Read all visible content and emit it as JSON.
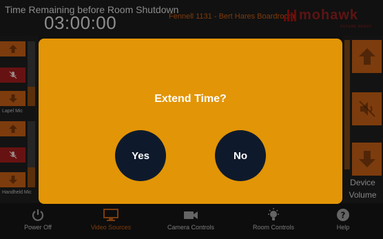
{
  "header": {
    "timer_label": "Time Remaining before Room Shutdown",
    "timer_value": "03:00:00",
    "room_name": "Fennell 1131 - Bert Hares Boardroom",
    "logo_text": "mohawk",
    "logo_tagline": "FUTURE READY"
  },
  "left_panel": {
    "channels": [
      {
        "label": "Lapel Mic",
        "level": 0.3
      },
      {
        "label": "Handheld Mic",
        "level": 0.3
      }
    ]
  },
  "right_panel": {
    "label_line1": "Device",
    "label_line2": "Volume"
  },
  "dialog": {
    "title": "Extend Time?",
    "yes_label": "Yes",
    "no_label": "No"
  },
  "footer": {
    "items": [
      {
        "label": "Power Off",
        "icon": "power-icon",
        "active": false
      },
      {
        "label": "Video Sources",
        "icon": "monitor-icon",
        "active": true
      },
      {
        "label": "Camera Controls",
        "icon": "camera-icon",
        "active": false
      },
      {
        "label": "Room Controls",
        "icon": "lightbulb-icon",
        "active": false
      },
      {
        "label": "Help",
        "icon": "help-icon",
        "active": false
      }
    ]
  },
  "colors": {
    "accent": "#c05c15",
    "dialog_bg": "#e29506",
    "dialog_button": "#0e1a2c",
    "mute": "#9f1d1d",
    "brand": "#8f2020"
  }
}
